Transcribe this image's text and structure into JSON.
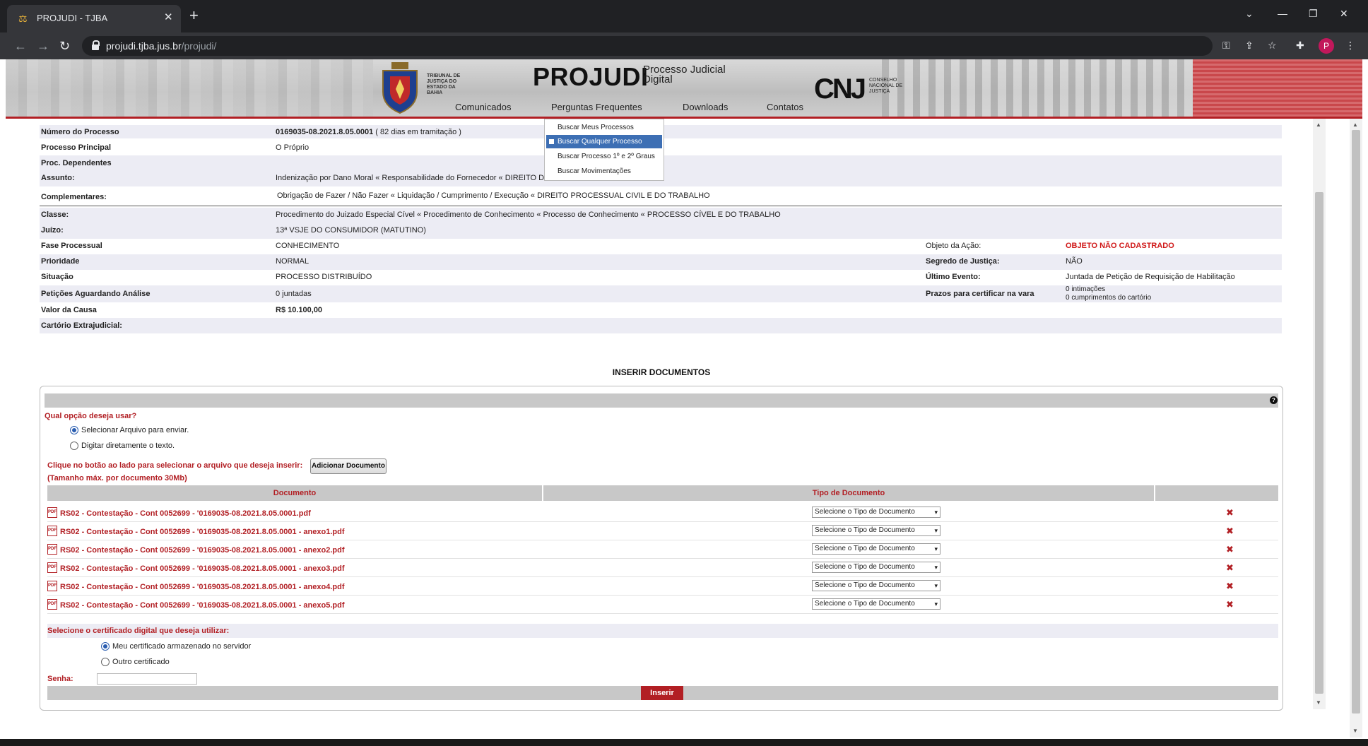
{
  "browser": {
    "tab_title": "PROJUDI - TJBA",
    "url_host": "projudi.tjba.jus.br",
    "url_path": "/projudi/",
    "avatar_letter": "P"
  },
  "header": {
    "tj_text": "TRIBUNAL DE JUSTIÇA DO ESTADO DA BAHIA",
    "title": "PROJUDI",
    "subtitle": "Processo Judicial Digital",
    "cnj_logo": "CNJ",
    "cnj_text": "CONSELHO NACIONAL DE JUSTIÇA",
    "menu": [
      "Comunicados",
      "Perguntas Frequentes",
      "Downloads",
      "Contatos"
    ]
  },
  "dropdown": {
    "items": [
      "Buscar Meus Processos",
      "Buscar Qualquer Processo",
      "Buscar Processo 1º e 2º Graus",
      "Buscar Movimentações"
    ]
  },
  "process": {
    "rows": [
      {
        "label": "Número do Processo",
        "value": "0169035-08.2021.8.05.0001",
        "extra": " ( 82 dias em tramitação )"
      },
      {
        "label": "Processo Principal",
        "value": "O Próprio"
      },
      {
        "label": "Proc. Dependentes",
        "value": ""
      },
      {
        "label": "Assunto:",
        "value": "Indenização por Dano Moral « Responsabilidade do Fornecedor « DIREITO DO CONSUMIDOR"
      },
      {
        "label": "Complementares:",
        "value": "Obrigação de Fazer / Não Fazer « Liquidação / Cumprimento / Execução « DIREITO PROCESSUAL CIVIL E DO TRABALHO"
      },
      {
        "label": "Classe:",
        "value": "Procedimento do Juizado Especial Cível « Procedimento de Conhecimento « Processo de Conhecimento « PROCESSO CÍVEL E DO TRABALHO"
      },
      {
        "label": "Juízo:",
        "value": "13ª VSJE DO CONSUMIDOR (MATUTINO)"
      },
      {
        "label": "Fase Processual",
        "value": "CONHECIMENTO",
        "label2": "Objeto da Ação:",
        "value2": "OBJETO NÃO CADASTRADO"
      },
      {
        "label": "Prioridade",
        "value": "NORMAL",
        "label2": "Segredo de Justiça:",
        "value2": "NÃO"
      },
      {
        "label": "Situação",
        "value": "PROCESSO DISTRIBUÍDO",
        "label2": "Último Evento:",
        "value2": "Juntada de Petição de Requisição de Habilitação"
      },
      {
        "label": "Petições Aguardando Análise",
        "value": "0 juntadas",
        "label2": "Prazos para certificar na vara",
        "value2a": "0 intimações",
        "value2b": "0 cumprimentos do cartório"
      },
      {
        "label": "Valor da Causa",
        "value": "R$ 10.100,00"
      },
      {
        "label": "Cartório Extrajudicial:",
        "value": ""
      }
    ]
  },
  "insert": {
    "section_title": "INSERIR DOCUMENTOS",
    "question": "Qual opção deseja usar?",
    "option_file": "Selecionar Arquivo para enviar.",
    "option_text": "Digitar diretamente o texto.",
    "click_instruction": "Clique no botão ao lado para selecionar o arquivo que deseja inserir:",
    "max_size": "(Tamanho máx. por documento 30Mb)",
    "add_button": "Adicionar Documento",
    "col_document": "Documento",
    "col_type": "Tipo de Documento",
    "select_placeholder": "Selecione o Tipo de Documento",
    "documents": [
      "RS02 - Contestação - Cont 0052699 - '0169035-08.2021.8.05.0001.pdf",
      "RS02 - Contestação - Cont 0052699 - '0169035-08.2021.8.05.0001 - anexo1.pdf",
      "RS02 - Contestação - Cont 0052699 - '0169035-08.2021.8.05.0001 - anexo2.pdf",
      "RS02 - Contestação - Cont 0052699 - '0169035-08.2021.8.05.0001 - anexo3.pdf",
      "RS02 - Contestação - Cont 0052699 - '0169035-08.2021.8.05.0001 - anexo4.pdf",
      "RS02 - Contestação - Cont 0052699 - '0169035-08.2021.8.05.0001 - anexo5.pdf"
    ],
    "certificate_question": "Selecione o certificado digital que deseja utilizar:",
    "cert_server": "Meu certificado armazenado no servidor",
    "cert_other": "Outro certificado",
    "password_label": "Senha:",
    "submit_button": "Inserir"
  },
  "colors": {
    "accent_red": "#b21f24",
    "dropdown_highlight": "#3d6fb4",
    "row_shade": "#ececf4"
  }
}
